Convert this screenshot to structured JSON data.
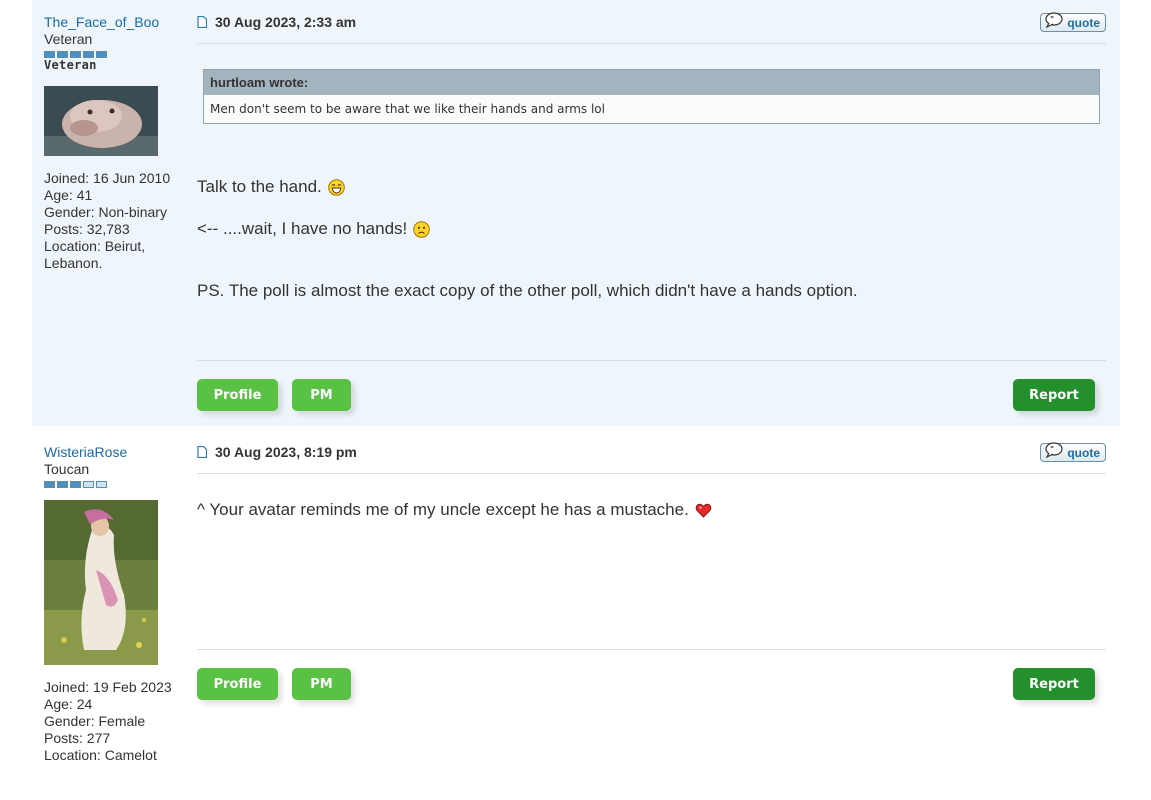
{
  "posts": [
    {
      "username": "The_Face_of_Boo",
      "rank": "Veteran",
      "rank_image_text": "Veteran",
      "rank_pips_filled": 5,
      "joined": "Joined: 16 Jun 2010",
      "age": "Age: 41",
      "gender": "Gender: Non-binary",
      "posts": "Posts: 32,783",
      "location_line1": "Location: Beirut,",
      "location_line2": "Lebanon.",
      "date": "30 Aug 2023, 2:33 am",
      "quote_button": "quote",
      "quote": {
        "author": "hurtloam wrote:",
        "text": "Men don't seem to be aware that we like their hands and arms lol"
      },
      "line1": "Talk to the hand.",
      "line2": "<-- ....wait, I have no hands!",
      "line3": "PS. The poll is almost the exact copy of the other poll, which didn't have a hands option.",
      "buttons": {
        "profile": "Profile",
        "pm": "PM",
        "report": "Report"
      }
    },
    {
      "username": "WisteriaRose",
      "rank": "Toucan",
      "rank_pips_filled": 3,
      "joined": "Joined: 19 Feb 2023",
      "age": "Age: 24",
      "gender": "Gender: Female",
      "posts": "Posts: 277",
      "location": "Location: Camelot",
      "date": "30 Aug 2023, 8:19 pm",
      "quote_button": "quote",
      "line1": "^ Your avatar reminds me of my uncle except he has a mustache.",
      "buttons": {
        "profile": "Profile",
        "pm": "PM",
        "report": "Report"
      }
    }
  ],
  "colors": {
    "username": "#1a6aa6",
    "post_bg_alt": "#eef6fb",
    "button_green": "#59c244",
    "button_dark_green": "#23902b"
  }
}
